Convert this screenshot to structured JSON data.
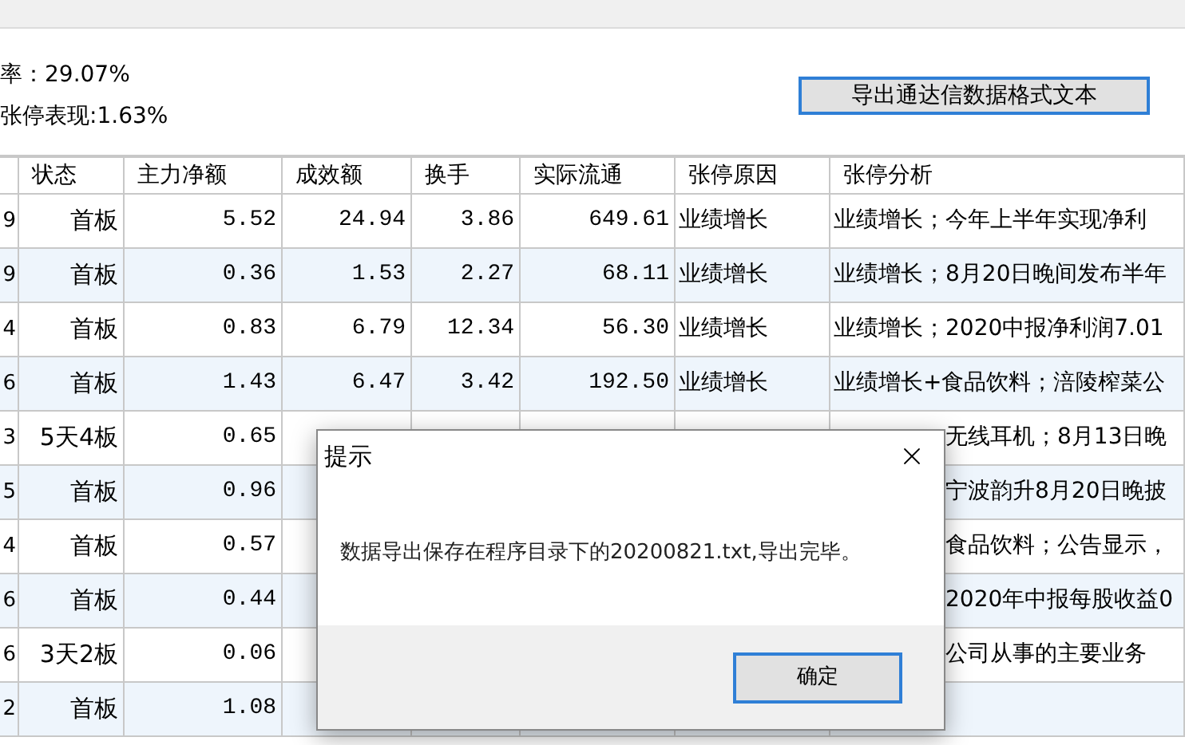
{
  "summary": {
    "rate": "率：29.07%",
    "performance": "张停表现:1.63%"
  },
  "export_button": "导出通达信数据格式文本",
  "table": {
    "columns": [
      "状态",
      "主力净额",
      "成效额",
      "换手",
      "实际流通",
      "张停原因",
      "张停分析"
    ],
    "rows": [
      {
        "column_1": "9",
        "status": "首板",
        "net": "5.52",
        "amount": "24.94",
        "turnover": "3.86",
        "float": "649.61",
        "reason": "业绩增长",
        "analysis": "业绩增长；今年上半年实现净利"
      },
      {
        "column_1": "9",
        "status": "首板",
        "net": "0.36",
        "amount": "1.53",
        "turnover": "2.27",
        "float": "68.11",
        "reason": "业绩增长",
        "analysis": "业绩增长；8月20日晚间发布半年"
      },
      {
        "column_1": "4",
        "status": "首板",
        "net": "0.83",
        "amount": "6.79",
        "turnover": "12.34",
        "float": "56.30",
        "reason": "业绩增长",
        "analysis": "业绩增长；2020中报净利润7.01"
      },
      {
        "column_1": "6",
        "status": "首板",
        "net": "1.43",
        "amount": "6.47",
        "turnover": "3.42",
        "float": "192.50",
        "reason": "业绩增长",
        "analysis": "业绩增长+食品饮料；涪陵榨菜公"
      },
      {
        "column_1": "3",
        "status": "5天4板",
        "net": "0.65",
        "analysis": "无线耳机；8月13日晚"
      },
      {
        "column_1": "5",
        "status": "首板",
        "net": "0.96",
        "analysis": "宁波韵升8月20日晚披"
      },
      {
        "column_1": "4",
        "status": "首板",
        "net": "0.57",
        "analysis": "食品饮料；公告显示，"
      },
      {
        "column_1": "6",
        "status": "首板",
        "net": "0.44",
        "analysis": "2020年中报每股收益0"
      },
      {
        "column_1": "6",
        "status": "3天2板",
        "net": "0.06",
        "analysis": "公司从事的主要业务"
      },
      {
        "column_1": "2",
        "status": "首板",
        "net": "1.08"
      }
    ]
  },
  "dialog": {
    "title": "提示",
    "message": "数据导出保存在程序目录下的20200821.txt,导出完毕。",
    "ok_button": "确定"
  }
}
